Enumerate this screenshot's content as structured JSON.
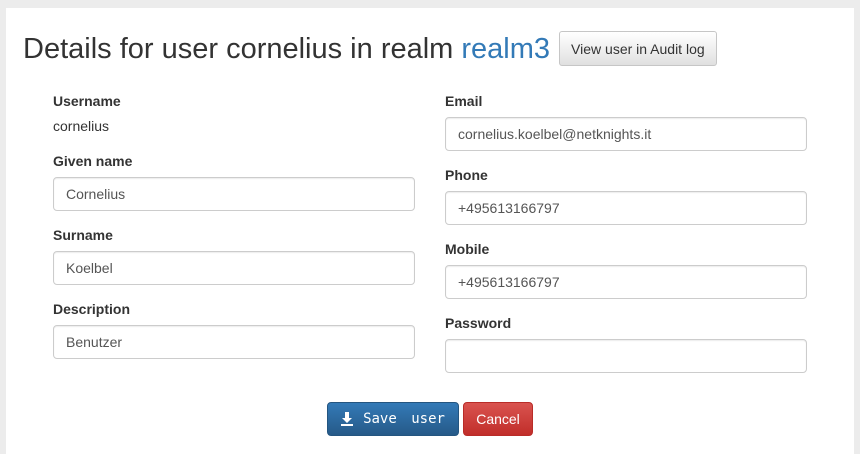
{
  "header": {
    "title_prefix": "Details for user cornelius in realm",
    "realm_name": "realm3",
    "audit_button_label": "View user in Audit log"
  },
  "fields": {
    "username": {
      "label": "Username",
      "value": "cornelius"
    },
    "given_name": {
      "label": "Given name",
      "value": "Cornelius"
    },
    "surname": {
      "label": "Surname",
      "value": "Koelbel"
    },
    "description": {
      "label": "Description",
      "value": "Benutzer"
    },
    "email": {
      "label": "Email",
      "value": "cornelius.koelbel@netknights.it"
    },
    "phone": {
      "label": "Phone",
      "value": "+495613166797"
    },
    "mobile": {
      "label": "Mobile",
      "value": "+495613166797"
    },
    "password": {
      "label": "Password",
      "value": ""
    }
  },
  "actions": {
    "save_label": "Save user",
    "save_icon": "download-icon",
    "cancel_label": "Cancel"
  },
  "colors": {
    "link": "#337ab7",
    "primary": "#337ab7",
    "danger": "#d9534f"
  }
}
